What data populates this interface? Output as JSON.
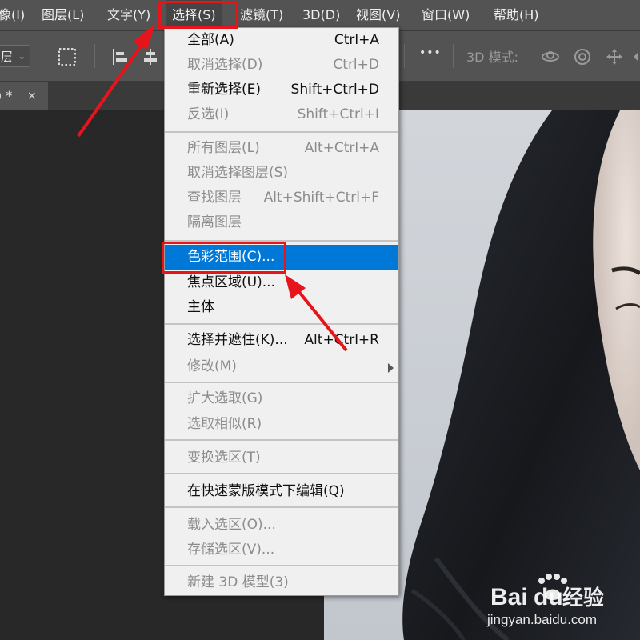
{
  "menubar": {
    "items": [
      "像(I)",
      "图层(L)",
      "文字(Y)",
      "选择(S)",
      "滤镜(T)",
      "3D(D)",
      "视图(V)",
      "窗口(W)",
      "帮助(H)"
    ],
    "active_index": 3
  },
  "optionsbar": {
    "layer_select": "层",
    "mode_label": "3D 模式:",
    "more_label": "•••"
  },
  "document_tab": {
    "label": ") *",
    "close": "×"
  },
  "select_menu": {
    "items": [
      {
        "label": "全部(A)",
        "shortcut": "Ctrl+A",
        "enabled": true
      },
      {
        "label": "取消选择(D)",
        "shortcut": "Ctrl+D",
        "enabled": false
      },
      {
        "label": "重新选择(E)",
        "shortcut": "Shift+Ctrl+D",
        "enabled": true
      },
      {
        "label": "反选(I)",
        "shortcut": "Shift+Ctrl+I",
        "enabled": false
      },
      {
        "label": "所有图层(L)",
        "shortcut": "Alt+Ctrl+A",
        "enabled": false
      },
      {
        "label": "取消选择图层(S)",
        "shortcut": "",
        "enabled": false
      },
      {
        "label": "查找图层",
        "shortcut": "Alt+Shift+Ctrl+F",
        "enabled": false
      },
      {
        "label": "隔离图层",
        "shortcut": "",
        "enabled": false
      },
      {
        "label": "色彩范围(C)...",
        "shortcut": "",
        "enabled": true,
        "highlighted": true
      },
      {
        "label": "焦点区域(U)...",
        "shortcut": "",
        "enabled": true
      },
      {
        "label": "主体",
        "shortcut": "",
        "enabled": true
      },
      {
        "label": "选择并遮住(K)...",
        "shortcut": "Alt+Ctrl+R",
        "enabled": true
      },
      {
        "label": "修改(M)",
        "shortcut": "",
        "enabled": false,
        "submenu": true
      },
      {
        "label": "扩大选取(G)",
        "shortcut": "",
        "enabled": false
      },
      {
        "label": "选取相似(R)",
        "shortcut": "",
        "enabled": false
      },
      {
        "label": "变换选区(T)",
        "shortcut": "",
        "enabled": false
      },
      {
        "label": "在快速蒙版模式下编辑(Q)",
        "shortcut": "",
        "enabled": true
      },
      {
        "label": "载入选区(O)...",
        "shortcut": "",
        "enabled": false
      },
      {
        "label": "存储选区(V)...",
        "shortcut": "",
        "enabled": false
      },
      {
        "label": "新建 3D 模型(3)",
        "shortcut": "",
        "enabled": false
      }
    ]
  },
  "watermark": {
    "brand_left": "Bai",
    "brand_right": "du",
    "brand_cn": "经验",
    "url": "jingyan.baidu.com"
  },
  "colors": {
    "highlight": "#0078d7",
    "annotation_red": "#e8141b",
    "menubar_bg": "#535353",
    "menu_bg": "#f0f0f0"
  }
}
